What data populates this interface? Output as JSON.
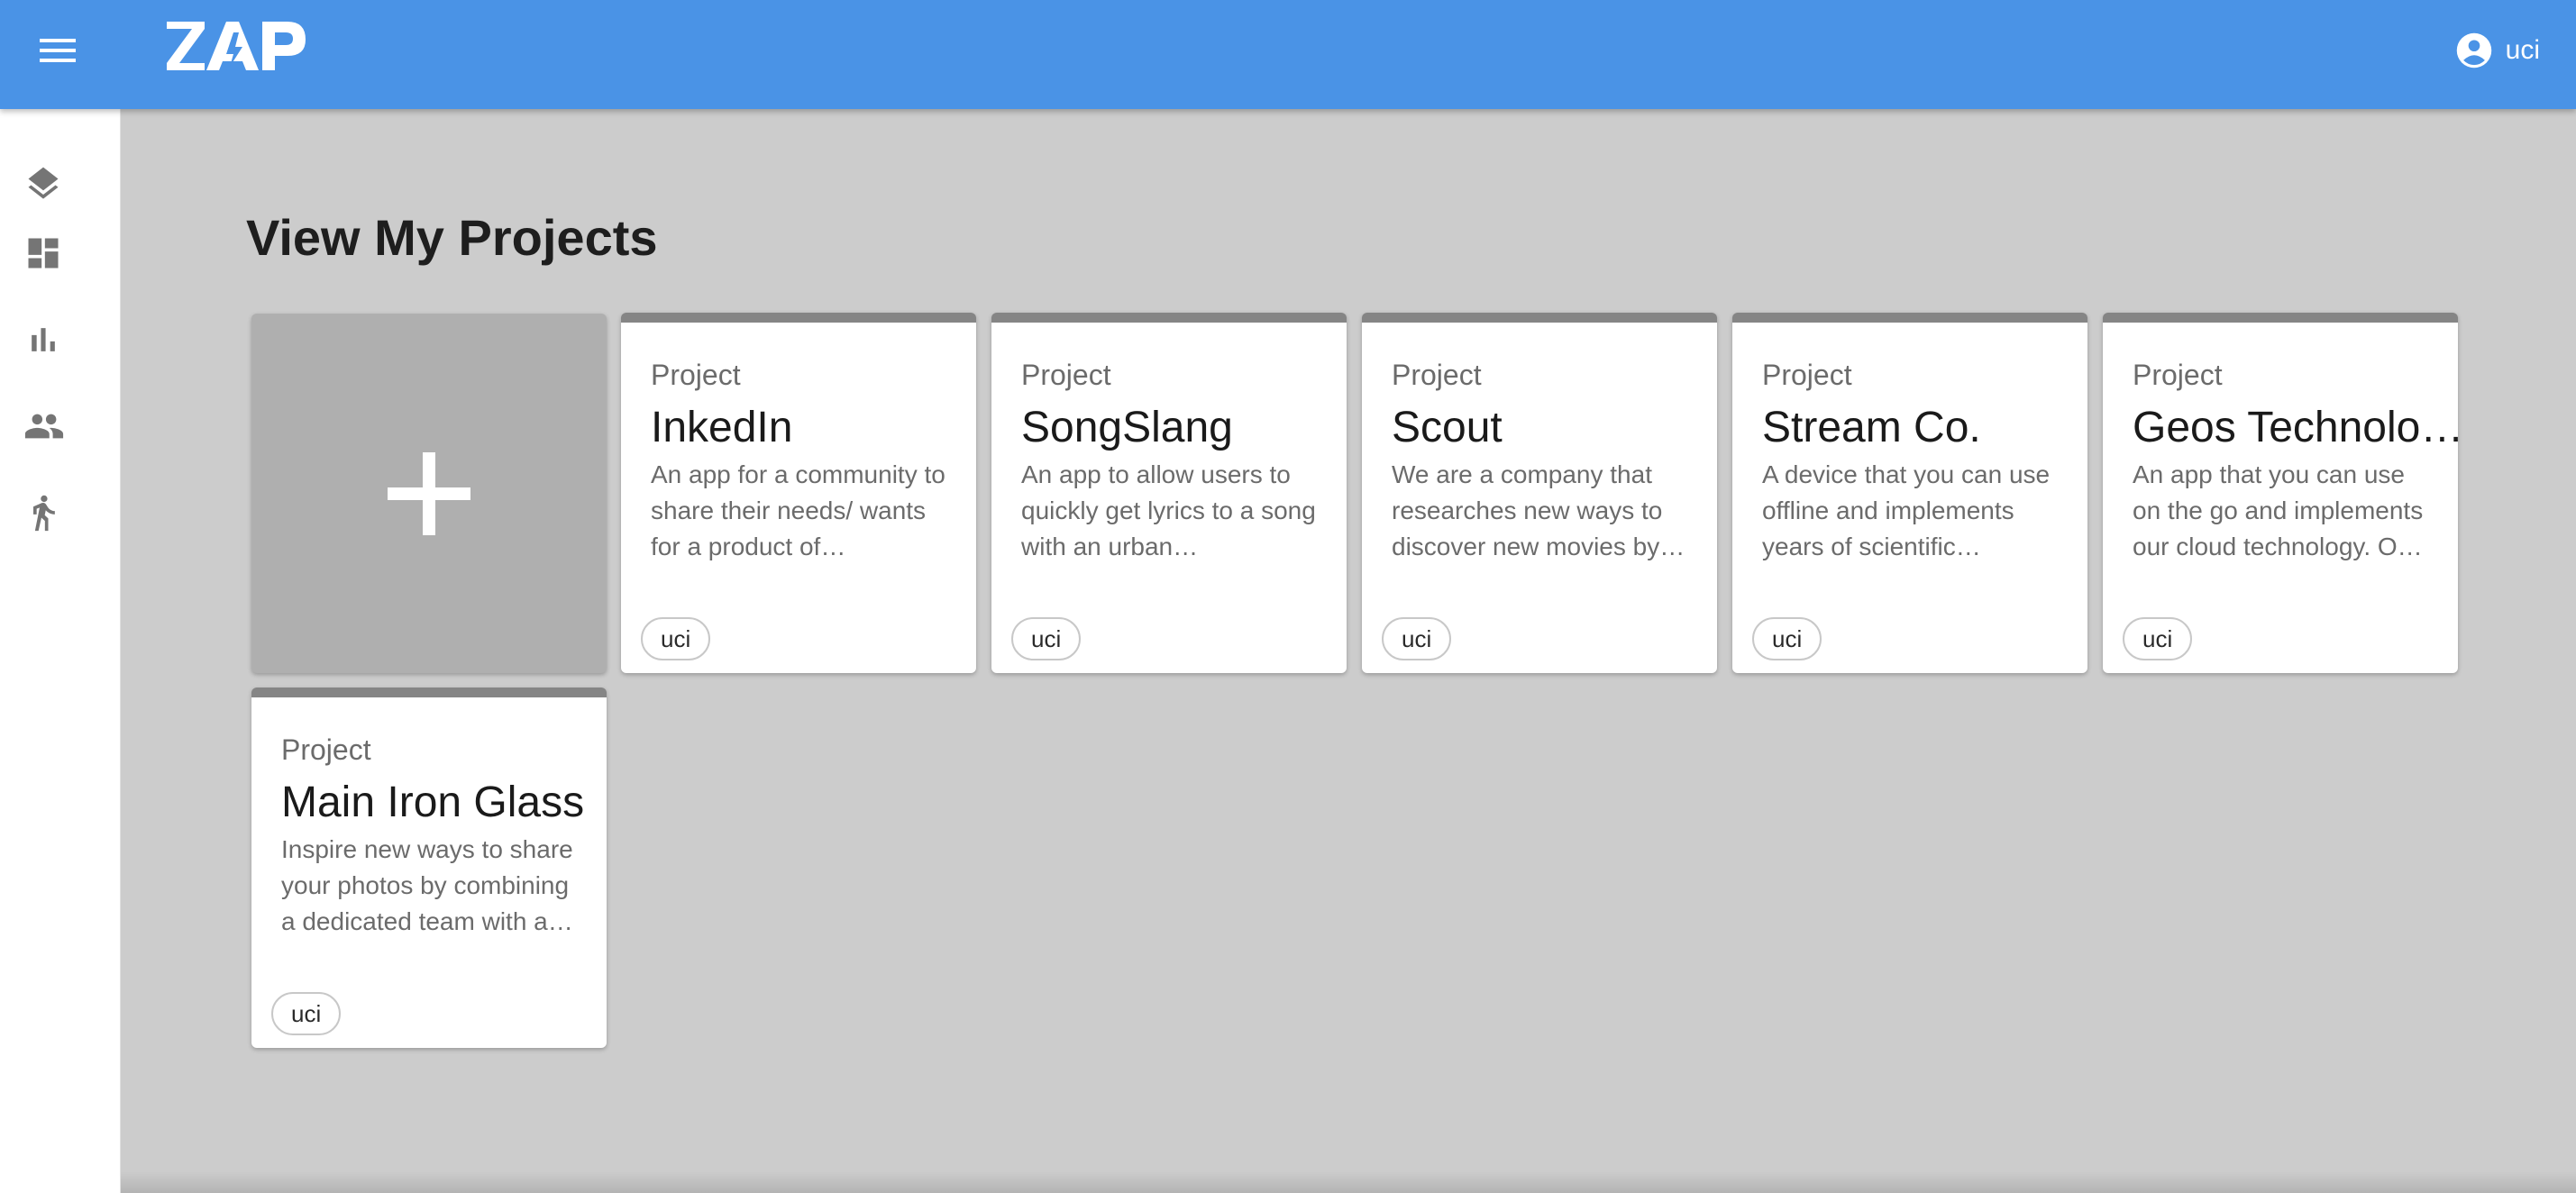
{
  "app": {
    "logo_text": "ZAP",
    "brand_color": "#4a93e6"
  },
  "user": {
    "name": "uci"
  },
  "sidebar": {
    "items": [
      {
        "name": "layers-icon"
      },
      {
        "name": "dashboard-icon"
      },
      {
        "name": "bar-chart-icon"
      },
      {
        "name": "people-icon"
      },
      {
        "name": "accessibility-icon"
      }
    ]
  },
  "page": {
    "title": "View My Projects"
  },
  "add_card": {
    "icon": "plus-icon"
  },
  "projects": [
    {
      "label": "Project",
      "name": "InkedIn",
      "description": "An app for a community to share their needs/ wants for a product of…",
      "owner": "uci"
    },
    {
      "label": "Project",
      "name": "SongSlang",
      "description": "An app to allow users to quickly get lyrics to a song with an urban…",
      "owner": "uci"
    },
    {
      "label": "Project",
      "name": "Scout",
      "description": "We are a company that researches new ways to discover new movies by…",
      "owner": "uci"
    },
    {
      "label": "Project",
      "name": "Stream Co.",
      "description": "A device that you can use offline and implements years of scientific…",
      "owner": "uci"
    },
    {
      "label": "Project",
      "name": "Geos Technolo…",
      "description": "An app that you can use on the go and implements our cloud technology. O…",
      "owner": "uci"
    },
    {
      "label": "Project",
      "name": "Main Iron Glass",
      "description": "Inspire new ways to share your photos by combining a dedicated team with a…",
      "owner": "uci"
    }
  ]
}
